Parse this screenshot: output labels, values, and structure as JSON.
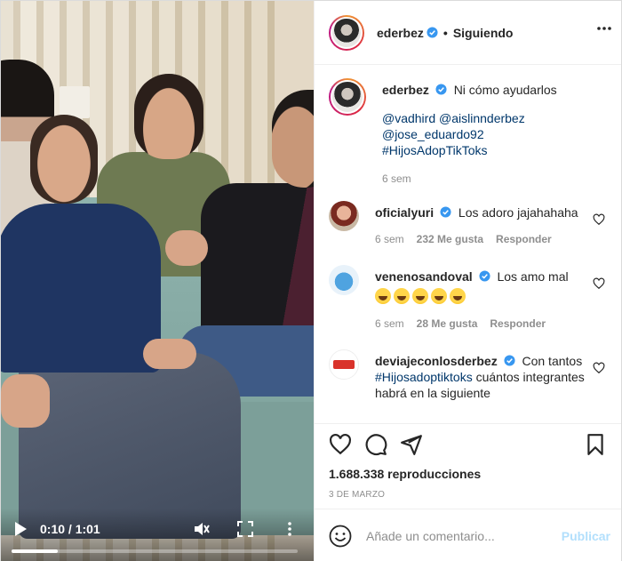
{
  "post": {
    "author": "ederbez",
    "follow_status": "Siguiendo",
    "separator": "•"
  },
  "video": {
    "time_display": "0:10 / 1:01",
    "progress_fraction": 0.16
  },
  "caption": {
    "username": "ederbez",
    "text": "Ni cómo ayudarlos",
    "tags_line1": "@vadhird @aislinnderbez",
    "tags_line2_a": "@jose_eduardo92",
    "tags_line2_b": "#HijosAdopTikToks",
    "time": "6 sem"
  },
  "comments": [
    {
      "username": "oficialyuri",
      "text": "Los adoro jajahahaha",
      "time": "6 sem",
      "likes": "232 Me gusta",
      "reply": "Responder"
    },
    {
      "username": "venenosandoval",
      "text": "Los amo mal",
      "emojis": 5,
      "time": "6 sem",
      "likes": "28 Me gusta",
      "reply": "Responder"
    },
    {
      "username": "deviajeconlosderbez",
      "text_a": "Con tantos",
      "tag": "#Hijosadoptiktoks",
      "text_b": "cuántos integrantes habrá en la siguiente"
    }
  ],
  "stats": {
    "views": "1.688.338 reproducciones",
    "date": "3 DE MARZO"
  },
  "add_comment": {
    "placeholder": "Añade un comentario...",
    "publish": "Publicar"
  },
  "colors": {
    "link": "#00376b",
    "verified": "#3897f0",
    "publish_disabled": "#b2dffc",
    "muted": "#8e8e8e"
  },
  "icons": [
    "more-icon",
    "verified-icon",
    "heart-icon",
    "comment-icon",
    "share-icon",
    "bookmark-icon",
    "emoji-icon",
    "play-icon",
    "mute-icon",
    "fullscreen-icon"
  ]
}
